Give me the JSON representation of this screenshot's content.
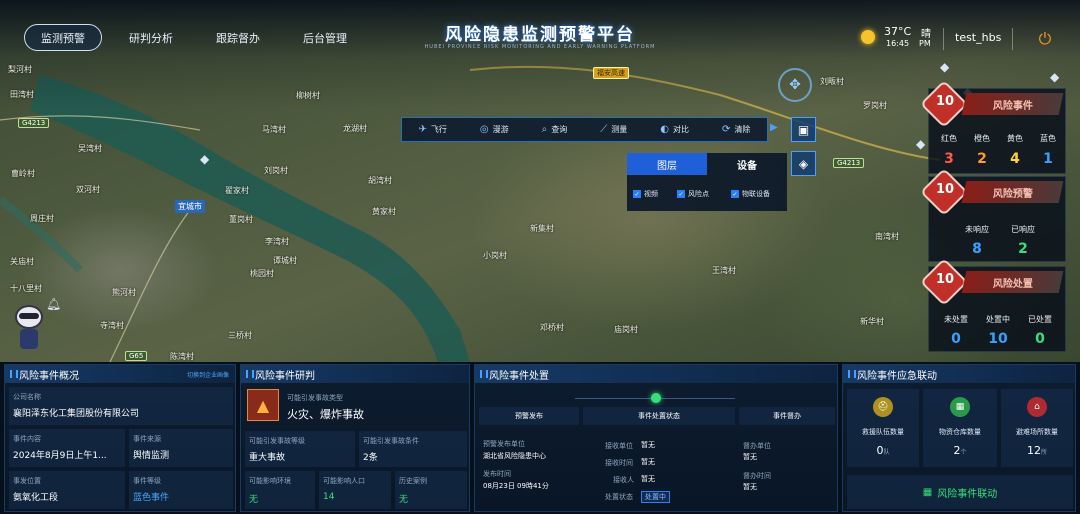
{
  "header": {
    "nav": [
      "监测预警",
      "研判分析",
      "跟踪督办",
      "后台管理"
    ],
    "title": "风险隐患监测预警平台",
    "subtitle": "HUBEI PROVINCE RISK MONITORING AND EARLY WARNING PLATFORM",
    "weather": {
      "temp": "37°C",
      "time": "16:45",
      "cond": "晴",
      "ampm": "PM"
    },
    "user": "test_hbs"
  },
  "map": {
    "places": [
      "梨河村",
      "田湾村",
      "柳树村",
      "龙湖村",
      "马湾村",
      "刘岗村",
      "胡湾村",
      "黄家村",
      "曹岭村",
      "周庄村",
      "吴湾村",
      "翟家村",
      "董岗村",
      "李湾村",
      "谭城村",
      "小岗村",
      "新集村",
      "王湾村",
      "邓桥村",
      "庙岗村",
      "三桥村",
      "陈湾村",
      "熊河村",
      "寺湾村",
      "南湾村",
      "刘畈村",
      "罗岗村",
      "十八里村",
      "桃园村",
      "关庙村",
      "双河村",
      "新华村"
    ],
    "roads": [
      "G4213",
      "G65",
      "G4213",
      "福安高速"
    ],
    "city": "宜城市"
  },
  "toolbar": {
    "items": [
      {
        "icon": "fly-icon",
        "glyph": "✈",
        "label": "飞行"
      },
      {
        "icon": "globe-icon",
        "glyph": "◎",
        "label": "漫游"
      },
      {
        "icon": "query-icon",
        "glyph": "⌕",
        "label": "查询"
      },
      {
        "icon": "measure-icon",
        "glyph": "⟋",
        "label": "测量"
      },
      {
        "icon": "compare-icon",
        "glyph": "◐",
        "label": "对比"
      },
      {
        "icon": "clear-icon",
        "glyph": "⟳",
        "label": "清除"
      }
    ]
  },
  "layers": {
    "tabs": [
      "图层",
      "设备"
    ],
    "checks": [
      "视频",
      "风险点",
      "物联设备"
    ]
  },
  "risk_events": {
    "count": "10",
    "title": "风险事件",
    "labels": [
      "红色",
      "橙色",
      "黄色",
      "蓝色"
    ],
    "values": [
      "3",
      "2",
      "4",
      "1"
    ],
    "colors": [
      "#ff5a4a",
      "#ff9a30",
      "#ffd23a",
      "#3aa0ff"
    ]
  },
  "risk_warnings": {
    "count": "10",
    "title": "风险预警",
    "labels": [
      "未响应",
      "已响应"
    ],
    "values": [
      "8",
      "2"
    ],
    "colors": [
      "#3aa0ff",
      "#35e07a"
    ]
  },
  "risk_handling": {
    "count": "10",
    "title": "风险处置",
    "labels": [
      "未处置",
      "处置中",
      "已处置"
    ],
    "values": [
      "0",
      "10",
      "0"
    ],
    "colors": [
      "#3aa0ff",
      "#3aa0ff",
      "#35e07a"
    ]
  },
  "panel_overview": {
    "title": "风险事件概况",
    "link": "切换到企业画像",
    "company_k": "公司名称",
    "company_v": "襄阳泽东化工集团股份有限公司",
    "content_k": "事件内容",
    "content_v": "2024年8月9日上午1...",
    "source_k": "事件来源",
    "source_v": "舆情监测",
    "location_k": "事发位置",
    "location_v": "氨氧化工段",
    "level_k": "事件等级",
    "level_v": "蓝色事件"
  },
  "panel_analysis": {
    "title": "风险事件研判",
    "type_k": "可能引发事故类型",
    "type_v": "火灾、爆炸事故",
    "grade_k": "可能引发事故等级",
    "grade_v": "重大事故",
    "cond_k": "可能引发事故条件",
    "cond_v": "2条",
    "env_k": "可能影响环境",
    "env_v": "无",
    "pop_k": "可能影响人口",
    "pop_v": "14",
    "hist_k": "历史案例",
    "hist_v": "无"
  },
  "panel_handling": {
    "title": "风险事件处置",
    "cols": [
      "预警发布",
      "事件处置状态",
      "事件督办"
    ],
    "pub_unit_k": "预警发布单位",
    "pub_unit_v": "湖北省风险隐患中心",
    "pub_time_k": "发布时间",
    "pub_time_v": "08月23日 09時41分",
    "recv_unit_k": "接收单位",
    "recv_unit_v": "暂无",
    "recv_time_k": "接收时间",
    "recv_time_v": "暂无",
    "recv_person_k": "接收人",
    "recv_person_v": "暂无",
    "status_k": "处置状态",
    "status_v": "处置中",
    "sup_unit_k": "督办单位",
    "sup_unit_v": "暂无",
    "sup_time_k": "督办时间",
    "sup_time_v": "暂无"
  },
  "panel_emergency": {
    "title": "风险事件应急联动",
    "items": [
      {
        "icon": "rescue-team-icon",
        "label": "救援队伍数量",
        "value": "0",
        "unit": "队",
        "color": "#b09020"
      },
      {
        "icon": "warehouse-icon",
        "label": "物资仓库数量",
        "value": "2",
        "unit": "个",
        "color": "#2a9a4a"
      },
      {
        "icon": "shelter-icon",
        "label": "避难场所数量",
        "value": "12",
        "unit": "所",
        "color": "#b02a30"
      }
    ],
    "action": "风险事件联动"
  }
}
